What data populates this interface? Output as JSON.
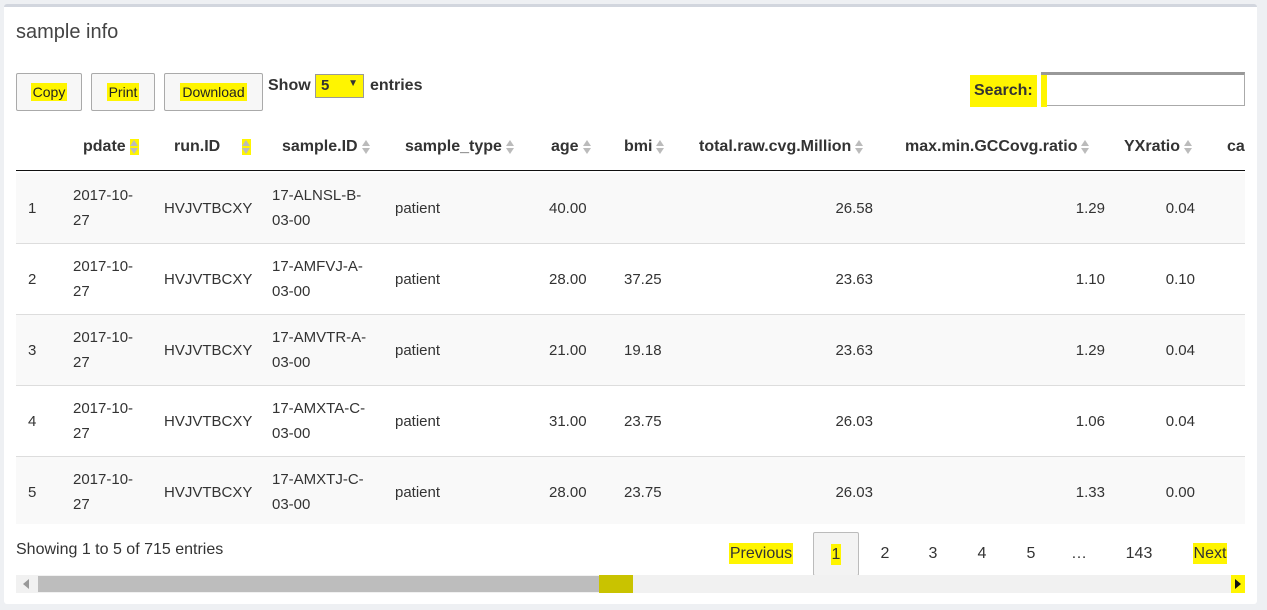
{
  "box": {
    "title": "sample info"
  },
  "toolbar": {
    "copy_label": "Copy",
    "print_label": "Print",
    "download_label": "Download",
    "show_label": "Show",
    "length_value": "5",
    "entries_label": "entries",
    "search_label": "Search:",
    "search_value": ""
  },
  "table": {
    "columns": [
      "",
      "pdate",
      "run.ID",
      "sample.ID",
      "sample_type",
      "age",
      "bmi",
      "total.raw.cvg.Million",
      "max.min.GCCovg.ratio",
      "YXratio",
      "ca"
    ],
    "rows": [
      {
        "idx": "1",
        "pdate_a": "2017-10-",
        "pdate_b": "27",
        "run": "HVJVTBCXY",
        "sid_a": "17-ALNSL-B-",
        "sid_b": "03-00",
        "type": "patient",
        "age": "40.00",
        "bmi": "",
        "cvg": "26.58",
        "gc": "1.29",
        "yx": "0.04"
      },
      {
        "idx": "2",
        "pdate_a": "2017-10-",
        "pdate_b": "27",
        "run": "HVJVTBCXY",
        "sid_a": "17-AMFVJ-A-",
        "sid_b": "03-00",
        "type": "patient",
        "age": "28.00",
        "bmi": "37.25",
        "cvg": "23.63",
        "gc": "1.10",
        "yx": "0.10"
      },
      {
        "idx": "3",
        "pdate_a": "2017-10-",
        "pdate_b": "27",
        "run": "HVJVTBCXY",
        "sid_a": "17-AMVTR-A-",
        "sid_b": "03-00",
        "type": "patient",
        "age": "21.00",
        "bmi": "19.18",
        "cvg": "23.63",
        "gc": "1.29",
        "yx": "0.04"
      },
      {
        "idx": "4",
        "pdate_a": "2017-10-",
        "pdate_b": "27",
        "run": "HVJVTBCXY",
        "sid_a": "17-AMXTA-C-",
        "sid_b": "03-00",
        "type": "patient",
        "age": "31.00",
        "bmi": "23.75",
        "cvg": "26.03",
        "gc": "1.06",
        "yx": "0.04"
      },
      {
        "idx": "5",
        "pdate_a": "2017-10-",
        "pdate_b": "27",
        "run": "HVJVTBCXY",
        "sid_a": "17-AMXTJ-C-",
        "sid_b": "03-00",
        "type": "patient",
        "age": "28.00",
        "bmi": "23.75",
        "cvg": "26.03",
        "gc": "1.33",
        "yx": "0.00"
      }
    ]
  },
  "footer": {
    "info": "Showing 1 to 5 of 715 entries",
    "previous": "Previous",
    "next": "Next",
    "pages": [
      "1",
      "2",
      "3",
      "4",
      "5",
      "…",
      "143"
    ]
  },
  "colors": {
    "highlight": "#fff500",
    "header_border": "#111111"
  }
}
